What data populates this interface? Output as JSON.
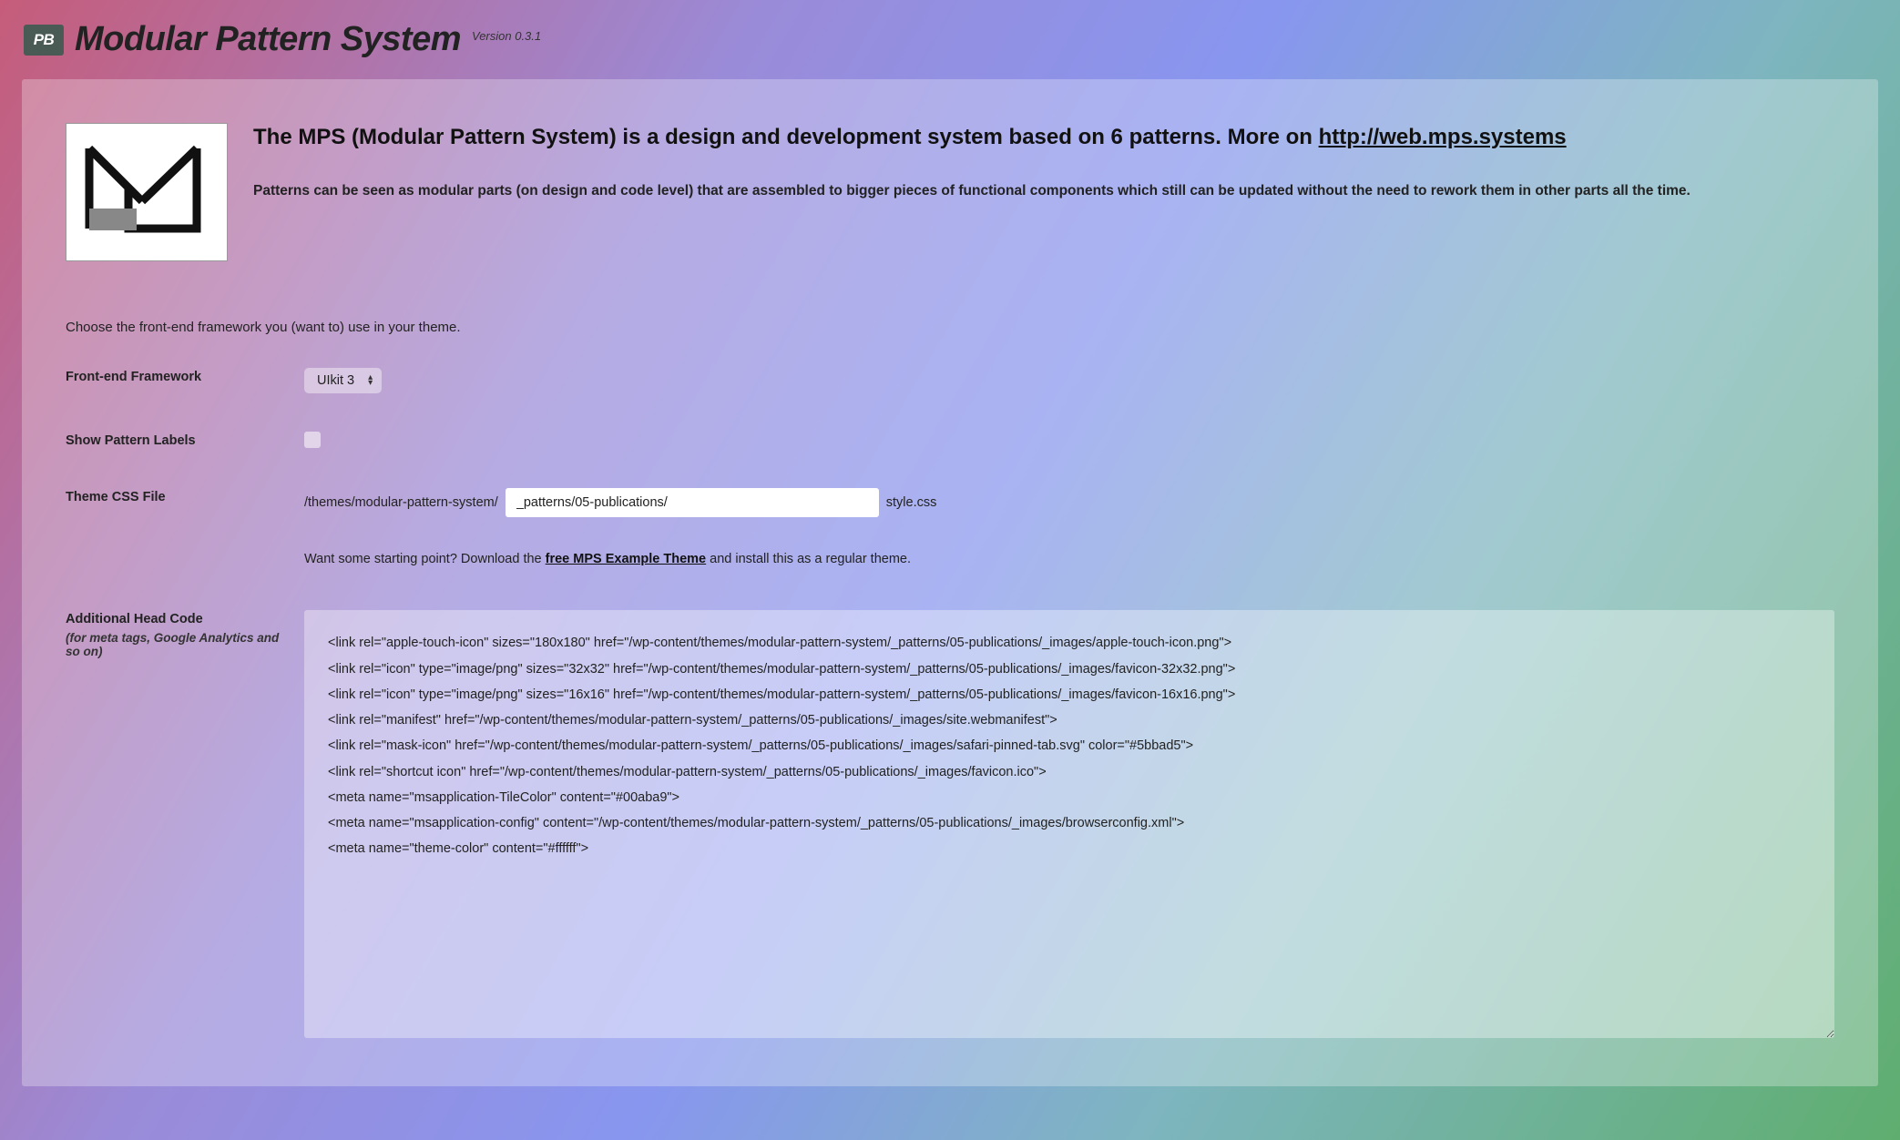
{
  "header": {
    "badge": "PB",
    "title": "Modular Pattern System",
    "version": "Version 0.3.1"
  },
  "intro": {
    "lead_pre": "The MPS (Modular Pattern System) is a design and development system based on 6 patterns. More on ",
    "lead_link": "http://web.mps.systems",
    "desc": "Patterns can be seen as modular parts (on design and code level) that are assembled to bigger pieces of functional components which still can be updated without the need to rework them in other parts all the time."
  },
  "choose_text": "Choose the front-end framework you (want to) use in your theme.",
  "form": {
    "framework_label": "Front-end Framework",
    "framework_value": "UIkit 3",
    "labels_label": "Show Pattern Labels",
    "css_label": "Theme CSS File",
    "css_prefix": "/themes/modular-pattern-system/",
    "css_value": "_patterns/05-publications/",
    "css_suffix": "style.css",
    "hint_pre": "Want some starting point? Download the ",
    "hint_link": "free MPS Example Theme",
    "hint_post": " and install this as a regular theme.",
    "head_label": "Additional Head Code",
    "head_sublabel": "(for meta tags, Google Analytics and so on)",
    "head_value": "<link rel=\"apple-touch-icon\" sizes=\"180x180\" href=\"/wp-content/themes/modular-pattern-system/_patterns/05-publications/_images/apple-touch-icon.png\">\n<link rel=\"icon\" type=\"image/png\" sizes=\"32x32\" href=\"/wp-content/themes/modular-pattern-system/_patterns/05-publications/_images/favicon-32x32.png\">\n<link rel=\"icon\" type=\"image/png\" sizes=\"16x16\" href=\"/wp-content/themes/modular-pattern-system/_patterns/05-publications/_images/favicon-16x16.png\">\n<link rel=\"manifest\" href=\"/wp-content/themes/modular-pattern-system/_patterns/05-publications/_images/site.webmanifest\">\n<link rel=\"mask-icon\" href=\"/wp-content/themes/modular-pattern-system/_patterns/05-publications/_images/safari-pinned-tab.svg\" color=\"#5bbad5\">\n<link rel=\"shortcut icon\" href=\"/wp-content/themes/modular-pattern-system/_patterns/05-publications/_images/favicon.ico\">\n<meta name=\"msapplication-TileColor\" content=\"#00aba9\">\n<meta name=\"msapplication-config\" content=\"/wp-content/themes/modular-pattern-system/_patterns/05-publications/_images/browserconfig.xml\">\n<meta name=\"theme-color\" content=\"#ffffff\">"
  }
}
